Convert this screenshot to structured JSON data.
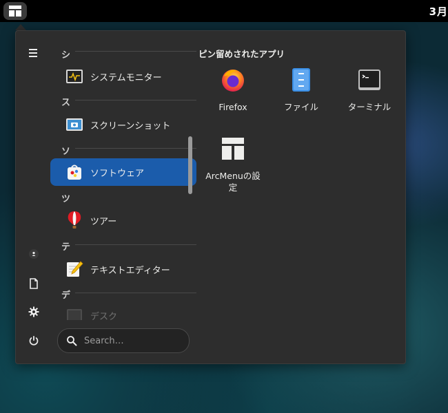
{
  "topbar": {
    "clock": "3月"
  },
  "sidebar": {
    "buttons": [
      {
        "icon": "menu-lines-icon"
      },
      {
        "icon": "user-icon"
      },
      {
        "icon": "document-icon"
      },
      {
        "icon": "gear-icon"
      },
      {
        "icon": "power-icon"
      }
    ]
  },
  "applist": {
    "headers": [
      "シ",
      "ス",
      "ソ",
      "ツ",
      "テ",
      "デ"
    ],
    "apps": [
      {
        "label": "システムモニター",
        "icon": "system-monitor-icon"
      },
      {
        "label": "スクリーンショット",
        "icon": "screenshot-icon"
      },
      {
        "label": "ソフトウェア",
        "icon": "software-icon",
        "selected": true
      },
      {
        "label": "ツアー",
        "icon": "tour-balloon-icon"
      },
      {
        "label": "テキストエディター",
        "icon": "text-editor-icon"
      },
      {
        "label": "デスク",
        "icon": "desk-icon"
      }
    ]
  },
  "search": {
    "placeholder": "Search…"
  },
  "pinned": {
    "title": "ピン留めされたアプリ",
    "apps": [
      {
        "label": "Firefox",
        "icon": "firefox-icon"
      },
      {
        "label": "ファイル",
        "icon": "files-icon"
      },
      {
        "label": "ターミナル",
        "icon": "terminal-icon"
      },
      {
        "label": "ArcMenuの設定",
        "icon": "arcmenu-settings-icon"
      }
    ]
  },
  "colors": {
    "accent": "#1b5cab",
    "menu_bg": "#2d2d2d",
    "topbar_bg": "#000000"
  }
}
